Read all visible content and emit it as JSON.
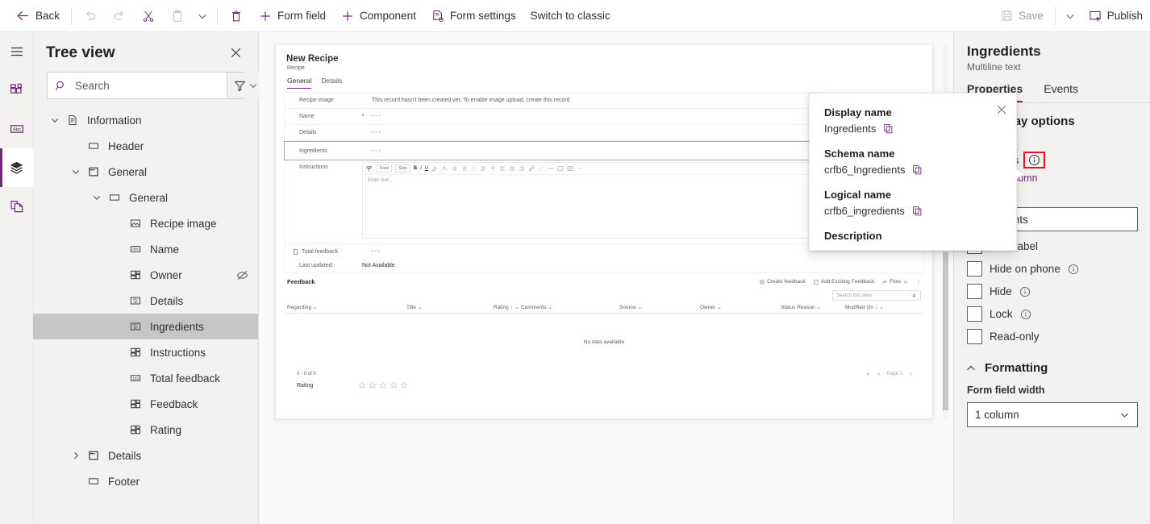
{
  "command_bar": {
    "back_label": "Back",
    "undo_label": "undo-icon",
    "redo_label": "redo-icon",
    "cut_label": "cut-icon",
    "paste_label": "paste-icon",
    "delete_label": "delete-icon",
    "form_field_label": "Form field",
    "component_label": "Component",
    "form_settings_label": "Form settings",
    "switch_to_classic_label": "Switch to classic",
    "save_label": "Save",
    "publish_label": "Publish"
  },
  "rail": {
    "items": [
      {
        "name": "menu-icon"
      },
      {
        "name": "components-icon"
      },
      {
        "name": "text-field-icon"
      },
      {
        "name": "layers-icon"
      },
      {
        "name": "copy-pages-icon"
      }
    ]
  },
  "tree_panel": {
    "title": "Tree view",
    "close_label": "close-icon",
    "search": {
      "value": "",
      "placeholder": "Search"
    },
    "filter_label": "filter-icon",
    "nodes": [
      {
        "label": "Information",
        "icon": "document-icon",
        "indent": 0,
        "twisty": "down",
        "selected": false,
        "hidden_eye": false
      },
      {
        "label": "Header",
        "icon": "section-icon",
        "indent": 1,
        "twisty": "none",
        "selected": false,
        "hidden_eye": false
      },
      {
        "label": "General",
        "icon": "tab-icon",
        "indent": 1,
        "twisty": "down",
        "selected": false,
        "hidden_eye": false
      },
      {
        "label": "General",
        "icon": "section-icon",
        "indent": 2,
        "twisty": "down",
        "selected": false,
        "hidden_eye": false
      },
      {
        "label": "Recipe image",
        "icon": "image-icon",
        "indent": 3,
        "twisty": "none",
        "selected": false,
        "hidden_eye": false
      },
      {
        "label": "Name",
        "icon": "abc-icon",
        "indent": 3,
        "twisty": "none",
        "selected": false,
        "hidden_eye": false
      },
      {
        "label": "Owner",
        "icon": "lookup-icon",
        "indent": 3,
        "twisty": "none",
        "selected": false,
        "hidden_eye": true
      },
      {
        "label": "Details",
        "icon": "multiline-icon",
        "indent": 3,
        "twisty": "none",
        "selected": false,
        "hidden_eye": false
      },
      {
        "label": "Ingredients",
        "icon": "multiline-icon",
        "indent": 3,
        "twisty": "none",
        "selected": true,
        "hidden_eye": false
      },
      {
        "label": "Instructions",
        "icon": "lookup-icon",
        "indent": 3,
        "twisty": "none",
        "selected": false,
        "hidden_eye": false
      },
      {
        "label": "Total feedback",
        "icon": "number-icon",
        "indent": 3,
        "twisty": "none",
        "selected": false,
        "hidden_eye": false
      },
      {
        "label": "Feedback",
        "icon": "lookup-icon",
        "indent": 3,
        "twisty": "none",
        "selected": false,
        "hidden_eye": false
      },
      {
        "label": "Rating",
        "icon": "lookup-icon",
        "indent": 3,
        "twisty": "none",
        "selected": false,
        "hidden_eye": false
      },
      {
        "label": "Details",
        "icon": "tab-icon",
        "indent": 1,
        "twisty": "right",
        "selected": false,
        "hidden_eye": false
      },
      {
        "label": "Footer",
        "icon": "section-icon",
        "indent": 1,
        "twisty": "none",
        "selected": false,
        "hidden_eye": false
      }
    ]
  },
  "form_preview": {
    "record_title": "New Recipe",
    "entity_name": "Recipe",
    "tabs": [
      {
        "label": "General",
        "active": true
      },
      {
        "label": "Details",
        "active": false
      }
    ],
    "fields": [
      {
        "label": "Recipe image",
        "value": "This record hasn't been created yet. To enable image upload, create this record",
        "required": false,
        "selected": false
      },
      {
        "label": "Name",
        "value": "- - -",
        "required": true,
        "selected": false
      },
      {
        "label": "Details",
        "value": "- - -",
        "required": false,
        "selected": false
      },
      {
        "label": "Ingredients",
        "value": "- - -",
        "required": false,
        "selected": true
      }
    ],
    "instructions": {
      "label": "Instructions",
      "font_label": "Font",
      "size_label": "Size",
      "placeholder": "Enter text..."
    },
    "total_feedback": {
      "label": "Total feedback",
      "value": "- - -"
    },
    "last_updated": {
      "label": "Last updated:",
      "value": "Not Available"
    },
    "subgrid": {
      "title": "Feedback",
      "commands": [
        {
          "label": "Create feedback",
          "icon": "plus-circle-icon"
        },
        {
          "label": "Add Existing Feedback",
          "icon": "add-existing-icon"
        },
        {
          "label": "Flow",
          "icon": "flow-icon"
        }
      ],
      "overflow_label": "more-icon",
      "search_placeholder": "Search this view",
      "columns": [
        "Regarding",
        "Title",
        "Rating",
        "Comments",
        "Source",
        "Owner",
        "Status Reason",
        "Modified On"
      ],
      "sorted_column": "Rating",
      "sorted_column_2": "Modified On",
      "empty_text": "No data available",
      "record_count": "0 - 0 of 0",
      "page_label": "Page 1"
    },
    "rating": {
      "label": "Rating",
      "stars": 5,
      "filled": 0
    }
  },
  "properties_panel": {
    "title": "Ingredients",
    "subtitle": "Multiline text",
    "tabs": [
      {
        "label": "Properties",
        "active": true
      },
      {
        "label": "Events",
        "active": false
      }
    ],
    "display_options_header": "Display options",
    "column_label": "Column",
    "column_value": "Ingredients",
    "column_info_icon": "info-icon",
    "change_column_link": "Change column",
    "label_field_label": "Label",
    "label_field_value": "Ingredients",
    "checkboxes": [
      {
        "label": "Hide label",
        "checked": false,
        "info": false
      },
      {
        "label": "Hide on phone",
        "checked": false,
        "info": true
      },
      {
        "label": "Hide",
        "checked": false,
        "info": true
      },
      {
        "label": "Lock",
        "checked": false,
        "info": true
      },
      {
        "label": "Read-only",
        "checked": false,
        "info": false
      }
    ],
    "formatting_header": "Formatting",
    "form_field_width_label": "Form field width",
    "form_field_width_value": "1 column"
  },
  "callout": {
    "close_label": "close-icon",
    "entries": [
      {
        "label": "Display name",
        "value": "Ingredients",
        "copy": true
      },
      {
        "label": "Schema name",
        "value": "crfb6_Ingredients",
        "copy": true
      },
      {
        "label": "Logical name",
        "value": "crfb6_ingredients",
        "copy": true
      },
      {
        "label": "Description",
        "value": "",
        "copy": false
      }
    ]
  },
  "colors": {
    "brand_purple": "#742774",
    "highlight_red": "#e81123",
    "selected_gray": "#c8c6c4",
    "panel_gray": "#f3f2f1"
  }
}
